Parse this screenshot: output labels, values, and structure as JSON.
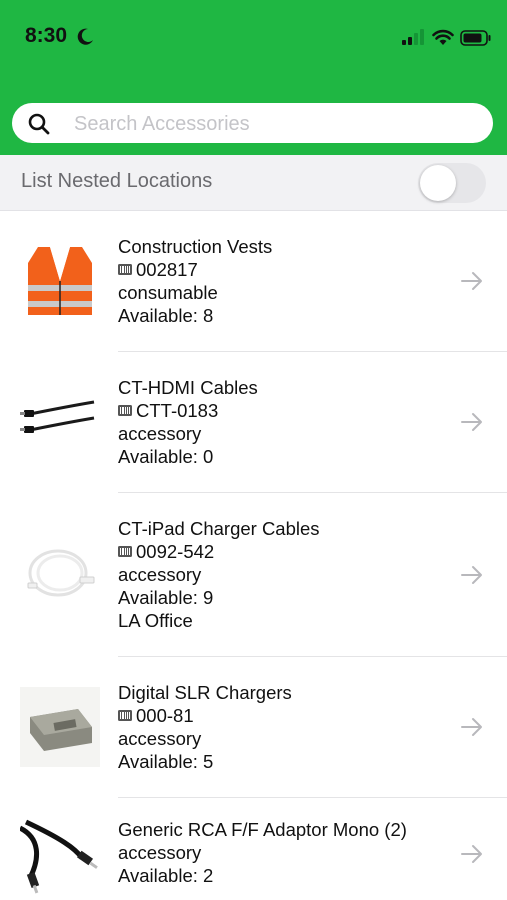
{
  "status_bar": {
    "time": "8:30"
  },
  "search": {
    "placeholder": "Search Accessories",
    "value": ""
  },
  "nested_locations": {
    "label": "List Nested Locations",
    "enabled": false
  },
  "colors": {
    "header": "#1fb743",
    "toggle_off": "#e6e6e9"
  },
  "items": [
    {
      "name": "Construction Vests",
      "tag": "002817",
      "category": "consumable",
      "available": "Available: 8",
      "location": "",
      "image": "safety-vest"
    },
    {
      "name": "CT-HDMI Cables",
      "tag": "CTT-0183",
      "category": "accessory",
      "available": "Available: 0",
      "location": "",
      "image": "hdmi-cable"
    },
    {
      "name": "CT-iPad Charger Cables",
      "tag": "0092-542",
      "category": "accessory",
      "available": "Available: 9",
      "location": "LA Office",
      "image": "usb-cable"
    },
    {
      "name": "Digital SLR Chargers",
      "tag": "000-81",
      "category": "accessory",
      "available": "Available: 5",
      "location": "",
      "image": "camera-battery"
    },
    {
      "name": "Generic RCA F/F Adaptor Mono (2)",
      "tag": "",
      "category": "accessory",
      "available": "Available: 2",
      "location": "",
      "image": "rca-cable"
    }
  ]
}
